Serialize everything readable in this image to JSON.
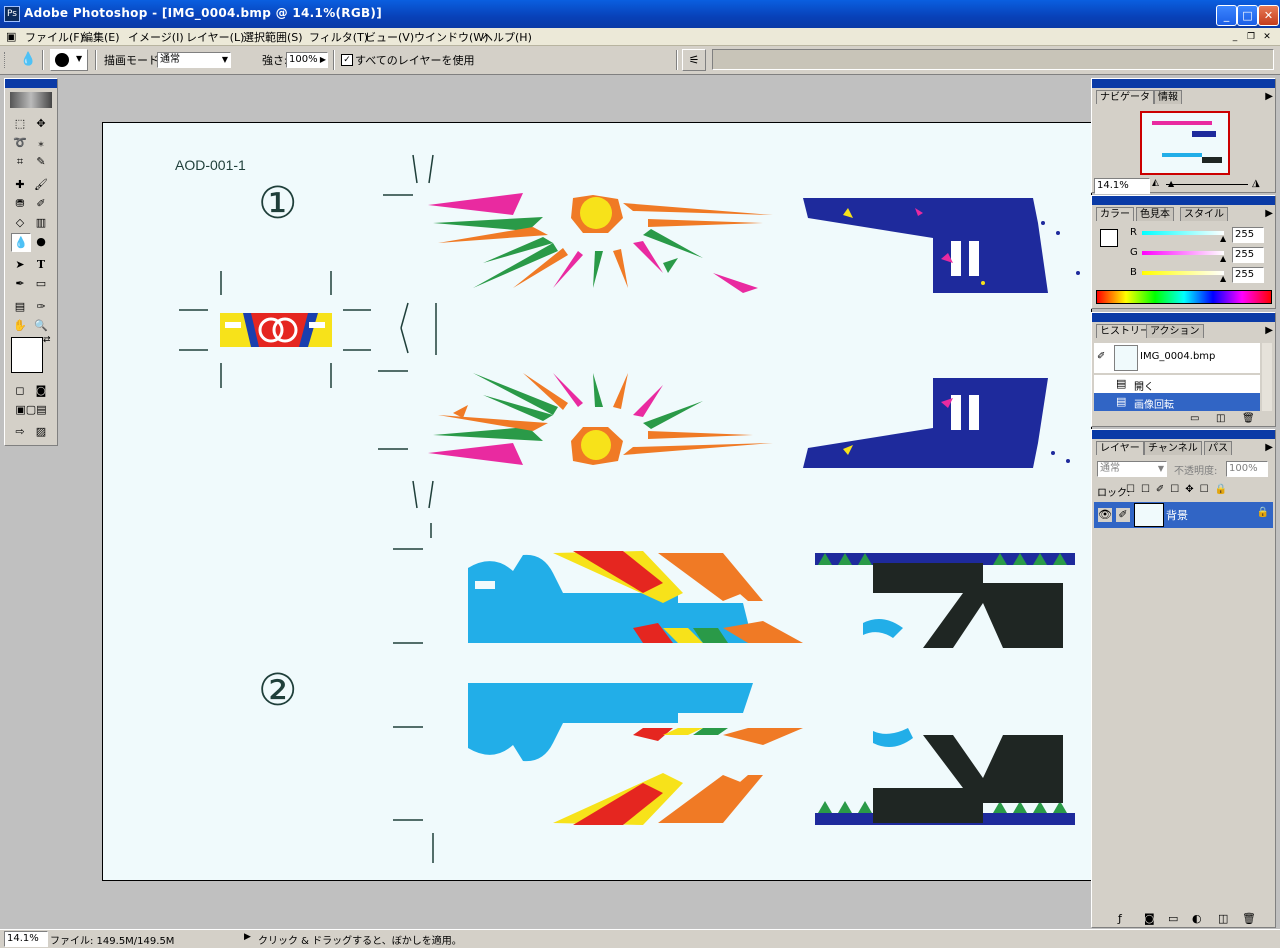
{
  "window": {
    "title": "Adobe Photoshop - [IMG_0004.bmp @ 14.1%(RGB)]"
  },
  "menu": [
    "ファイル(F)",
    "編集(E)",
    "イメージ(I)",
    "レイヤー(L)",
    "選択範囲(S)",
    "フィルタ(T)",
    "ビュー(V)",
    "ウインドウ(W)",
    "ヘルプ(H)"
  ],
  "options": {
    "mode_label": "描画モード",
    "mode_value": "通常",
    "strength_label": "強さ:",
    "strength_value": "100%",
    "all_layers_label": "すべてのレイヤーを使用"
  },
  "canvas": {
    "doc_code": "AOD-001-1",
    "mark_1": "①",
    "mark_2": "②"
  },
  "navigator": {
    "tabs": [
      "ナビゲータ",
      "情報"
    ],
    "zoom": "14.1%"
  },
  "color": {
    "tabs": [
      "カラー",
      "色見本",
      "スタイル"
    ],
    "r_label": "R",
    "g_label": "G",
    "b_label": "B",
    "r": "255",
    "g": "255",
    "b": "255",
    "r_fill": 1.0,
    "g_fill": 1.0,
    "b_fill": 1.0
  },
  "history": {
    "tabs": [
      "ヒストリー",
      "アクション"
    ],
    "snapshot": "IMG_0004.bmp",
    "items": [
      "開く",
      "画像回転"
    ]
  },
  "layers": {
    "tabs": [
      "レイヤー",
      "チャンネル",
      "パス"
    ],
    "blend": "通常",
    "opacity_label": "不透明度:",
    "opacity": "100%",
    "lock_label": "ロック:",
    "layer_name": "背景"
  },
  "status": {
    "zoom": "14.1%",
    "file": "ファイル: 149.5M/149.5M",
    "hint": "クリック & ドラッグすると、ぼかしを適用。"
  },
  "colors": {
    "accent": "#0a3aa6",
    "selected": "#3165c5"
  }
}
